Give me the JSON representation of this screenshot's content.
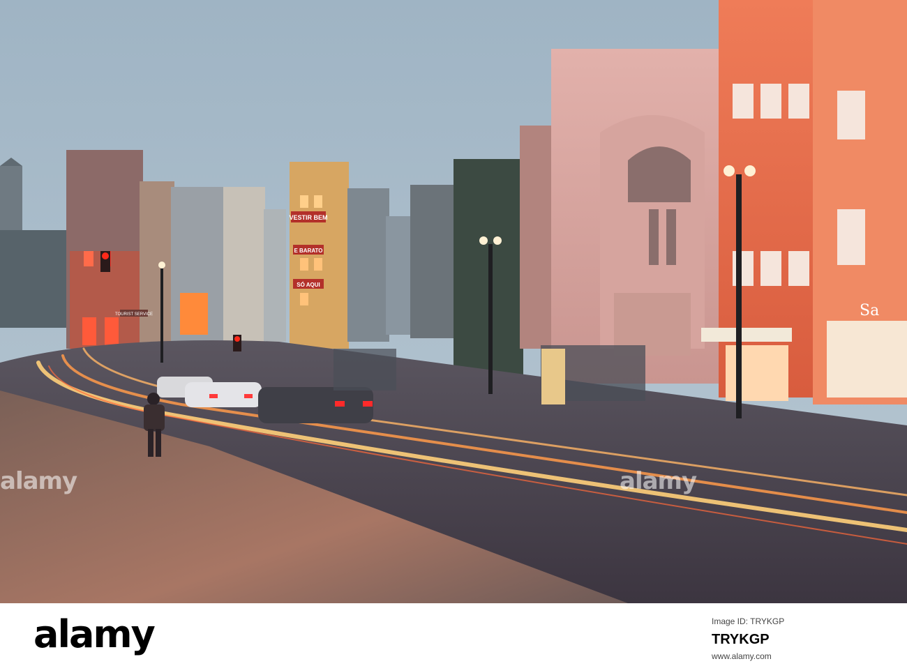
{
  "photo": {
    "description_icon": "city-street-photo",
    "signs": {
      "vestir_bem": "VESTIR BEM",
      "e_barato": "E BARATO",
      "so_aqui": "SÓ AQUI",
      "tourist_service": "TOURIST SERVICE",
      "bank": "Sa"
    },
    "colors": {
      "sky": "#a9bcc9",
      "street": "#4a4650",
      "light_trail": "#ffcf7a",
      "facade_pink": "#e7a8a4",
      "facade_orange": "#e96f4c"
    }
  },
  "watermarks": [
    "alamy",
    "alamy"
  ],
  "footer": {
    "logo": "alamy",
    "image_id_label": "Image ID: TRYKGP",
    "image_id": "TRYKGP",
    "url": "www.alamy.com"
  }
}
